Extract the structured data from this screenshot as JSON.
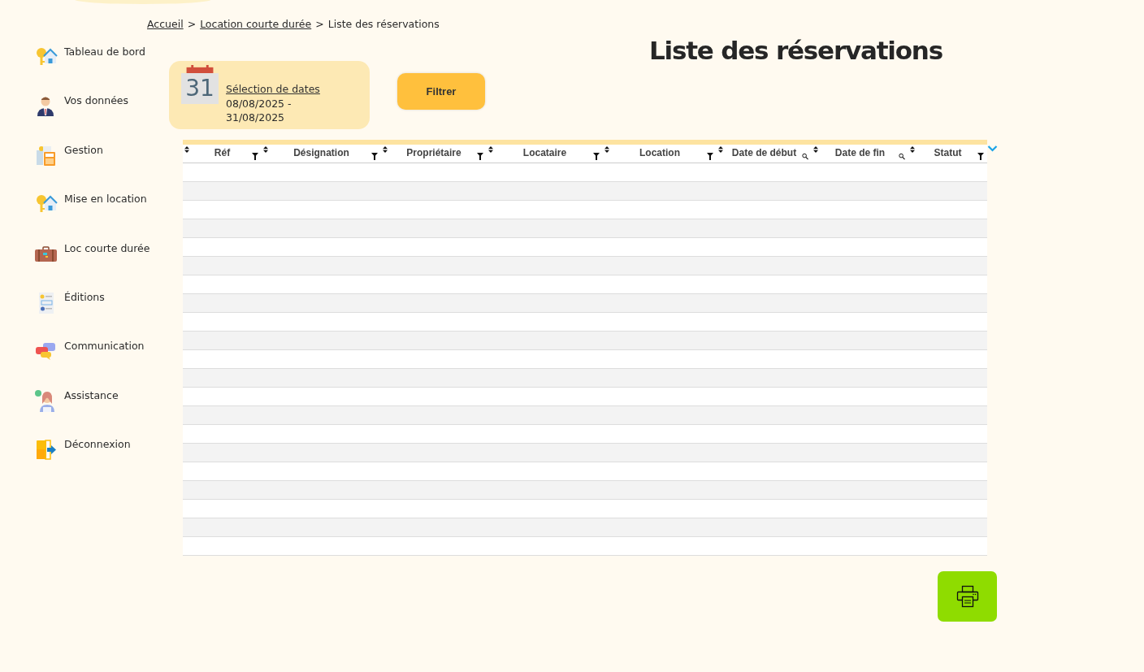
{
  "breadcrumb": [
    {
      "label": "Accueil",
      "link": true
    },
    {
      "label": "Location courte durée",
      "link": true
    },
    {
      "label": "Liste des réservations",
      "link": false
    }
  ],
  "breadcrumb_separator": ">",
  "sidebar": {
    "items": [
      {
        "label": "Tableau de bord"
      },
      {
        "label": "Vos données"
      },
      {
        "label": "Gestion"
      },
      {
        "label": "Mise en location"
      },
      {
        "label": "Loc courte durée"
      },
      {
        "label": "Éditions"
      },
      {
        "label": "Communication"
      },
      {
        "label": "Assistance"
      },
      {
        "label": "Déconnexion"
      }
    ]
  },
  "page_title": "Liste des réservations",
  "date_selector": {
    "day": "31",
    "link": "Sélection de dates",
    "range": "08/08/2025 - 31/08/2025"
  },
  "filter_button": "Filtrer",
  "table": {
    "columns": [
      {
        "label": "Réf",
        "kind": "filter"
      },
      {
        "label": "Désignation",
        "kind": "filter"
      },
      {
        "label": "Propriétaire",
        "kind": "filter"
      },
      {
        "label": "Locataire",
        "kind": "filter"
      },
      {
        "label": "Location",
        "kind": "filter"
      },
      {
        "label": "Date de début",
        "kind": "search"
      },
      {
        "label": "Date de fin",
        "kind": "search"
      },
      {
        "label": "Statut",
        "kind": "filter"
      }
    ]
  }
}
